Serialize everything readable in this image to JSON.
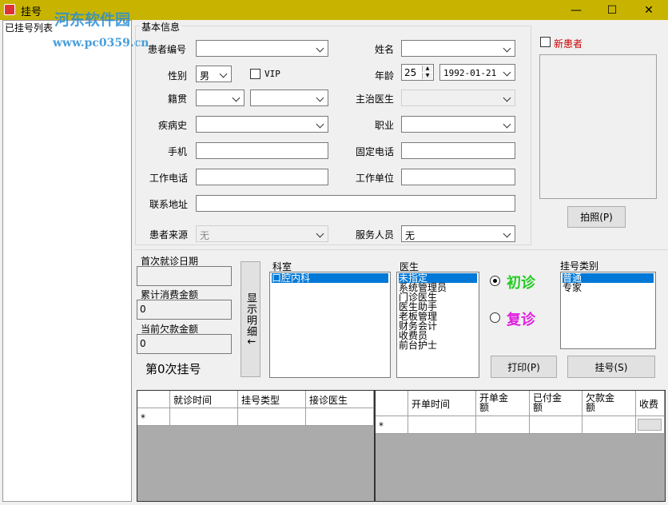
{
  "window": {
    "title": "挂号",
    "minimize": "—",
    "maximize": "☐",
    "close": "✕"
  },
  "watermark": {
    "line1": "河东软件园",
    "line2": "www.pc0359.cn"
  },
  "left_panel": {
    "title": "已挂号列表"
  },
  "basic_info": {
    "title": "基本信息",
    "patient_id_label": "患者编号",
    "patient_id_value": "",
    "name_label": "姓名",
    "name_value": "",
    "gender_label": "性别",
    "gender_value": "男",
    "vip_label": "VIP",
    "age_label": "年龄",
    "age_value": "25",
    "birth_value": "1992-01-21",
    "native_label": "籍贯",
    "doctor_label": "主治医生",
    "history_label": "疾病史",
    "job_label": "职业",
    "mobile_label": "手机",
    "phone_label": "固定电话",
    "work_phone_label": "工作电话",
    "work_unit_label": "工作单位",
    "address_label": "联系地址",
    "source_label": "患者来源",
    "source_value": "无",
    "service_label": "服务人员",
    "service_value": "无",
    "new_patient_label": "新患者",
    "photo_button": "拍照(P)"
  },
  "stats": {
    "first_visit_label": "首次就诊日期",
    "first_visit_value": "",
    "total_spent_label": "累计消费金额",
    "total_spent_value": "0",
    "owed_label": "当前欠款金额",
    "owed_value": "0",
    "visit_count": "第0次挂号",
    "detail_button": "显示明细↓"
  },
  "dept": {
    "label": "科室",
    "items": [
      "口腔内科"
    ]
  },
  "doctor": {
    "label": "医生",
    "items": [
      "未指定",
      "系统管理员",
      "门诊医生",
      "医生助手",
      "老板管理",
      "财务会计",
      "收费员",
      "前台护士"
    ]
  },
  "visit_type": {
    "first": "初诊",
    "return": "复诊"
  },
  "reg_type": {
    "label": "挂号类别",
    "items": [
      "普通",
      "专家"
    ]
  },
  "buttons": {
    "print": "打印(P)",
    "register": "挂号(S)"
  },
  "grid_left": {
    "headers": [
      "就诊时间",
      "挂号类型",
      "接诊医生"
    ],
    "new_row_marker": "*"
  },
  "grid_right": {
    "headers": [
      "开单时间",
      "开单金\n额",
      "已付金\n额",
      "欠款金\n额",
      "收费"
    ],
    "new_row_marker": "*"
  },
  "colors": {
    "titlebar": "#c8b400",
    "first_visit": "#22cc22",
    "return_visit": "#e020e0",
    "new_patient": "#cc0000",
    "selection": "#0078d7"
  }
}
